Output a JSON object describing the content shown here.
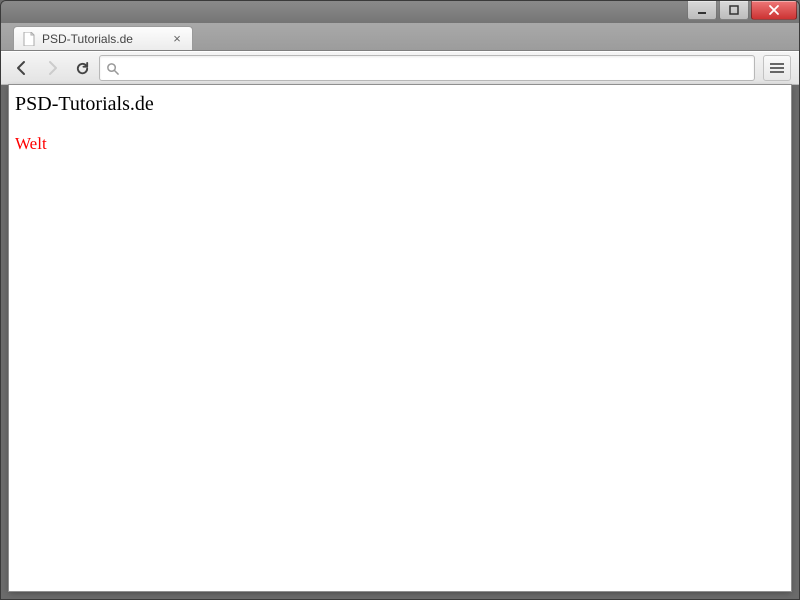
{
  "window": {
    "tab_title": "PSD-Tutorials.de"
  },
  "toolbar": {
    "url_value": ""
  },
  "page": {
    "heading": "PSD-Tutorials.de",
    "body_text": "Welt",
    "body_color": "#ff0000"
  }
}
